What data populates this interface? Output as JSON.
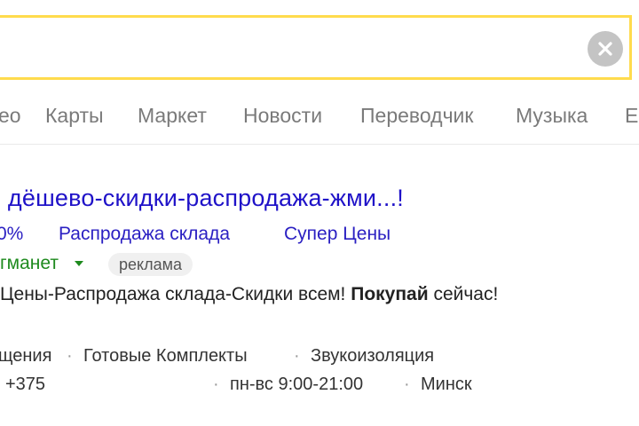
{
  "search": {
    "query": "",
    "clear_icon": "close-circle-icon"
  },
  "tabs": [
    "ео",
    "Карты",
    "Маркет",
    "Новости",
    "Переводчик",
    "Музыка",
    "Е"
  ],
  "ad": {
    "title": "- дёшево-скидки-распродажа-жми...!",
    "sitelinks": [
      "0%",
      "Распродажа склада",
      "Супер Цены"
    ],
    "path": "гманет",
    "badge": "реклама",
    "desc_start": "Цены-Распродажа склада-Скидки всем! ",
    "desc_bold": "Покупай",
    "desc_end": " сейчас!",
    "quicklinks": [
      "щения",
      "Готовые Комплекты",
      "Звукоизоляция"
    ],
    "phone": "+375",
    "hours": "пн-вс 9:00-21:00",
    "city": "Минск"
  },
  "colors": {
    "search_border": "#ffdb4d",
    "link": "#1f12c8",
    "url_green": "#1e8a1e"
  }
}
